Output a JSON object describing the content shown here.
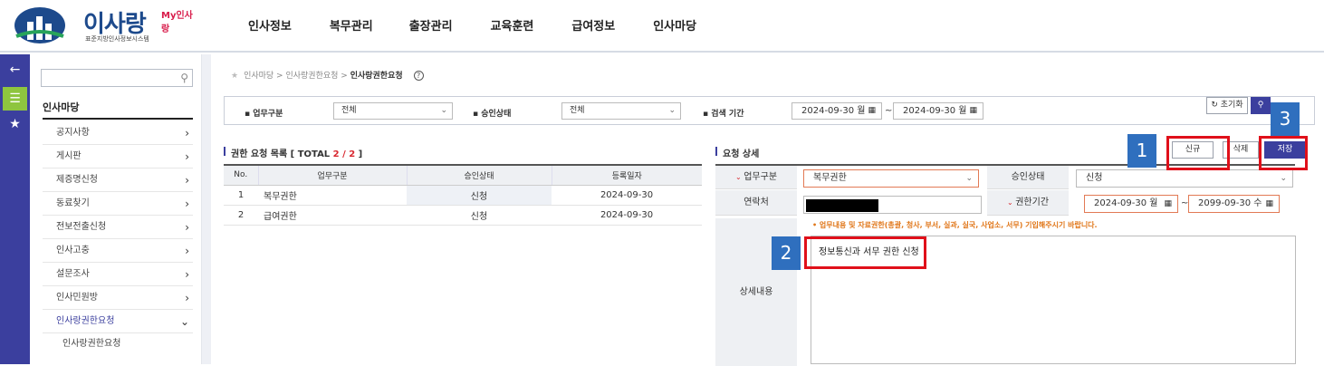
{
  "header": {
    "logo_text": "이사랑",
    "logo_my": "My인사랑",
    "logo_sub": "표준지방인사정보시스템",
    "nav": [
      "인사정보",
      "복무관리",
      "출장관리",
      "교육훈련",
      "급여정보",
      "인사마당"
    ]
  },
  "left_bar": {
    "icons": [
      "back-arrow-icon",
      "list-icon",
      "star-icon"
    ],
    "icon_glyphs": [
      "←",
      "☰",
      "★"
    ]
  },
  "sidebar": {
    "search_placeholder": "",
    "title": "인사마당",
    "items": [
      {
        "label": "공지사항",
        "chevron": "›"
      },
      {
        "label": "게시판",
        "chevron": "›"
      },
      {
        "label": "제증명신청",
        "chevron": "›"
      },
      {
        "label": "동료찾기",
        "chevron": "›"
      },
      {
        "label": "전보전출신청",
        "chevron": "›"
      },
      {
        "label": "인사고충",
        "chevron": "›"
      },
      {
        "label": "설문조사",
        "chevron": "›"
      },
      {
        "label": "인사민원방",
        "chevron": "›"
      },
      {
        "label": "인사랑권한요청",
        "chevron": "⌄"
      }
    ],
    "sub_items": [
      "인사랑권한요청"
    ]
  },
  "breadcrumb": {
    "path": "인사마당 > 인사랑권한요청 > ",
    "current": "인사랑권한요청",
    "help": "?"
  },
  "search": {
    "type_label": "업무구분",
    "type_value": "전체",
    "status_label": "승인상태",
    "status_value": "전체",
    "period_label": "검색 기간",
    "date_from": "2024-09-30 월",
    "date_to": "2024-09-30 월",
    "tilde": "~",
    "reset_label": "초기화",
    "search_icon": "🔍"
  },
  "list": {
    "title_prefix": "권한 요청 목록 [ TOTAL ",
    "count": "2 / 2",
    "title_suffix": " ]",
    "columns": [
      "No.",
      "업무구분",
      "승인상태",
      "등록일자"
    ],
    "rows": [
      {
        "no": "1",
        "type": "복무권한",
        "status": "신청",
        "date": "2024-09-30"
      },
      {
        "no": "2",
        "type": "급여권한",
        "status": "신청",
        "date": "2024-09-30"
      }
    ]
  },
  "detail": {
    "title": "요청 상세",
    "buttons": {
      "new": "신규",
      "delete": "삭제",
      "save": "저장"
    },
    "type_label": "업무구분",
    "type_value": "복무권한",
    "status_label": "승인상태",
    "status_value": "신청",
    "contact_label": "연락처",
    "period_label": "권한기간",
    "period_from": "2024-09-30 월",
    "period_to": "2099-09-30 수",
    "notice": "• 업무내용 및 자료권한(총괄, 청사, 부서, 실과, 실국, 사업소, 서무) 기입해주시기 바랍니다.",
    "detail_label": "상세내용",
    "detail_text": "정보통신과 서무 권한 신청"
  },
  "annotations": [
    "1",
    "2",
    "3"
  ]
}
